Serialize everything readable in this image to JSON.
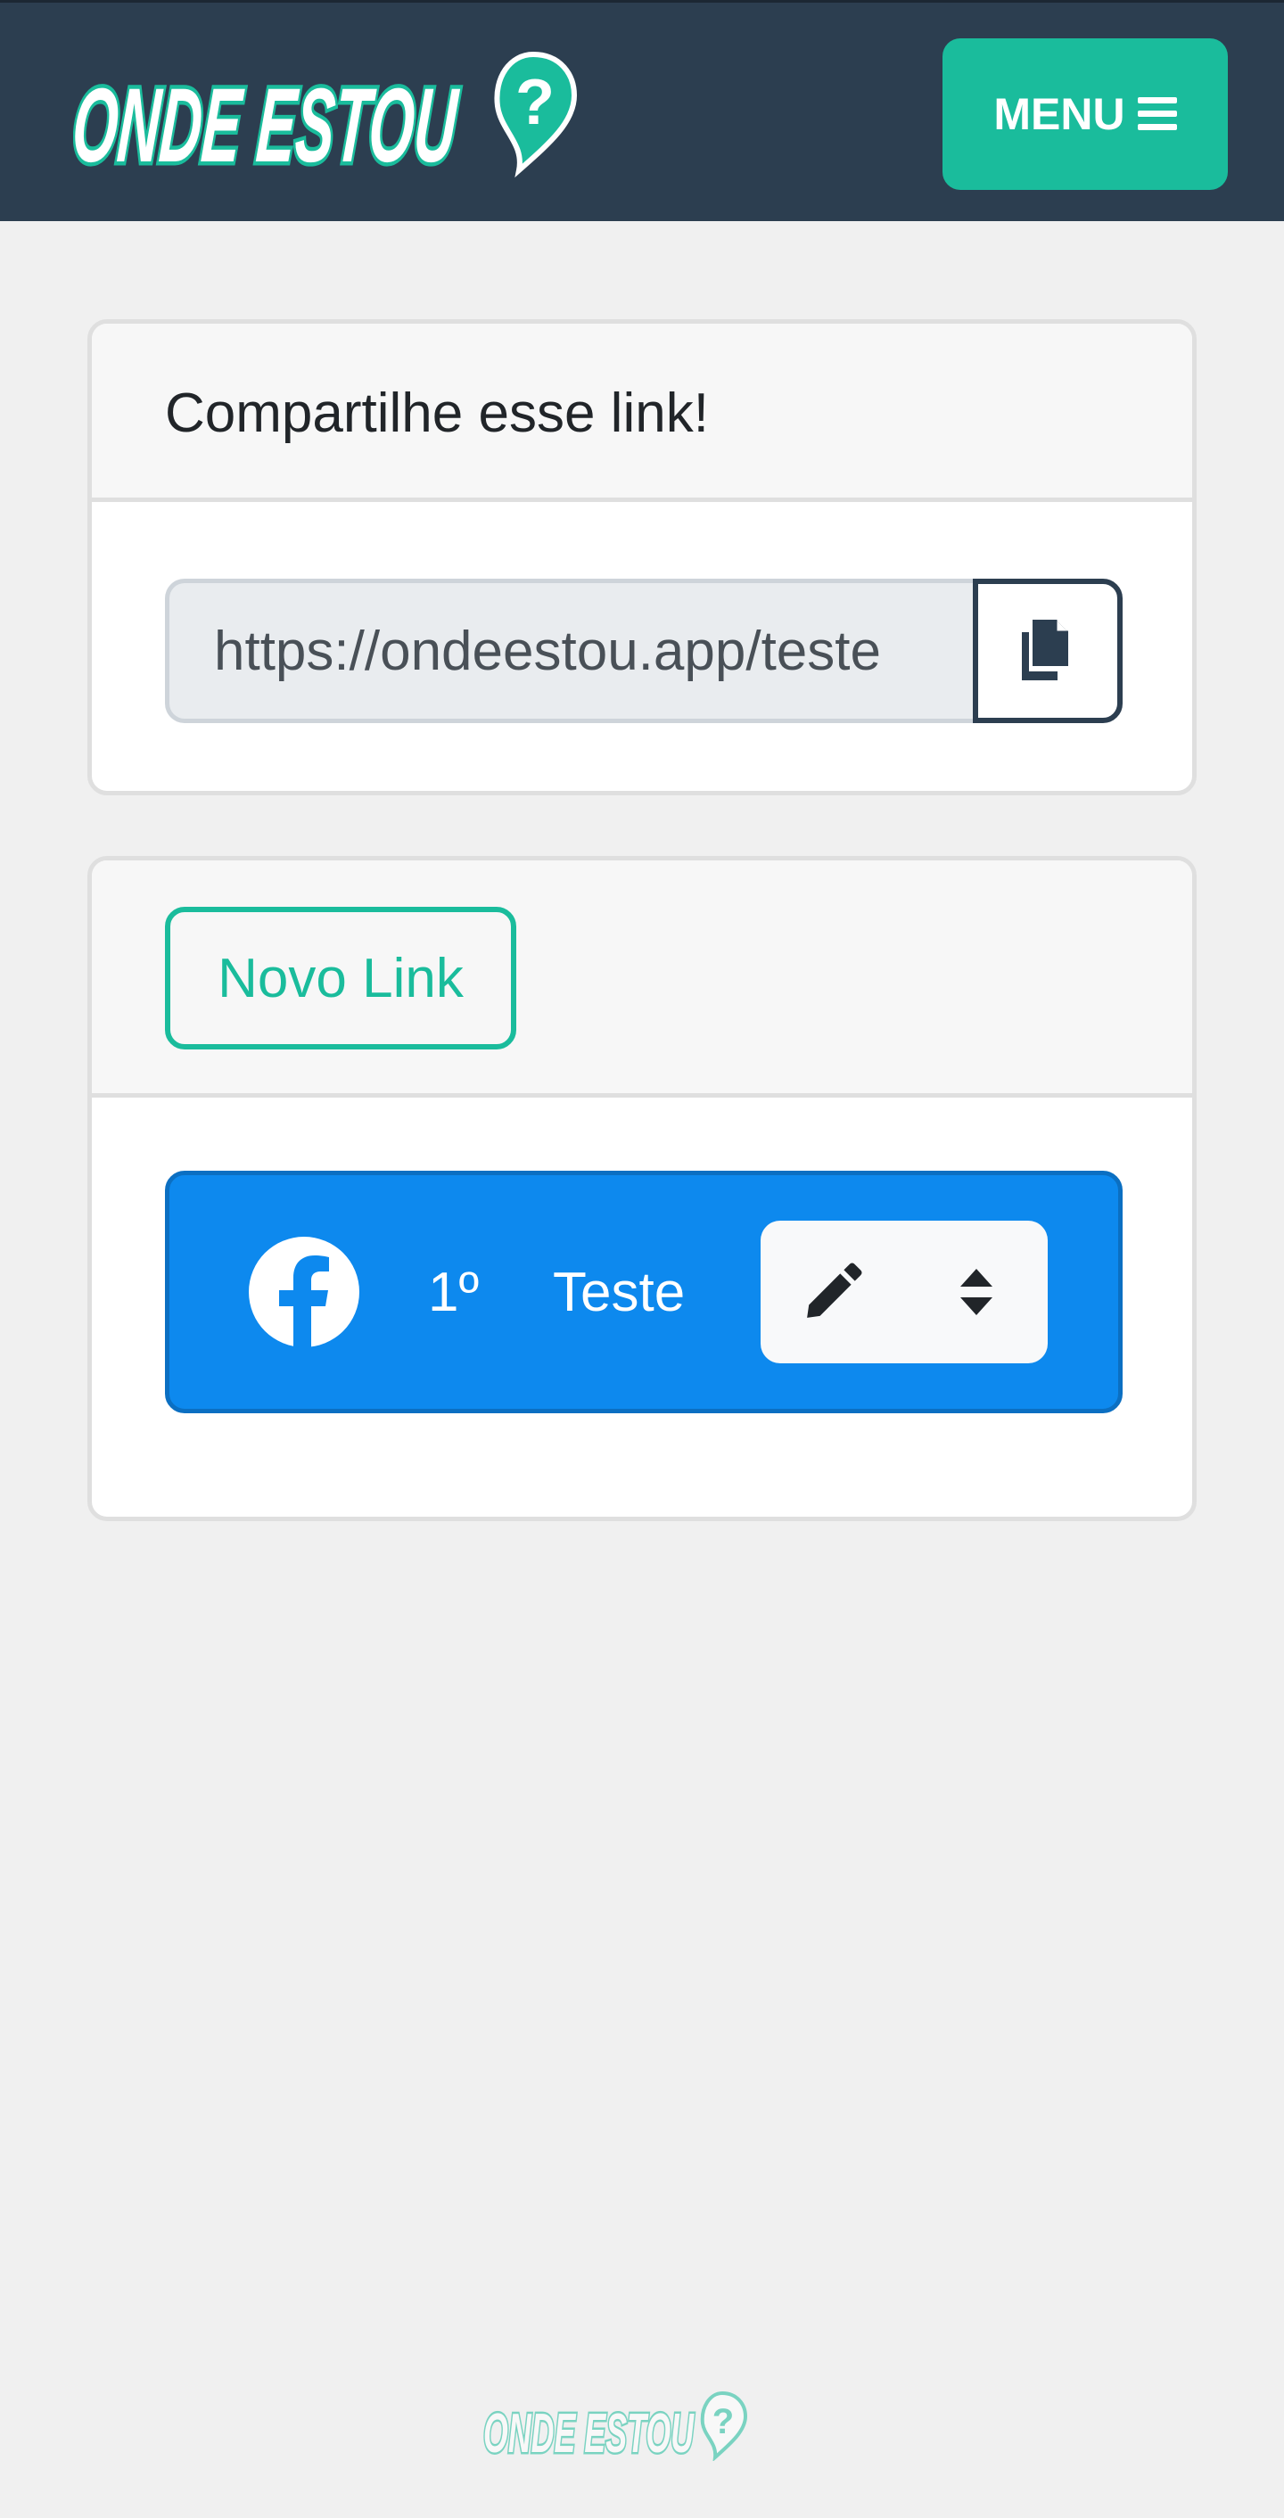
{
  "app": {
    "logo_text": "ONDE ESTOU",
    "brand_color": "#1abc9c",
    "navbar_color": "#2c3e50"
  },
  "navbar": {
    "menu_label": "MENU",
    "menu_icon": "bars-icon"
  },
  "share_card": {
    "title": "Compartilhe esse link!",
    "url_value": "https://ondeestou.app/teste",
    "copy_icon": "copy-icon"
  },
  "links_card": {
    "new_link_label": "Novo Link",
    "items": [
      {
        "icon": "facebook-icon",
        "order": "1º",
        "name": "Teste",
        "color": "#0d89ee",
        "actions": [
          "pencil-icon",
          "sort-icon"
        ]
      }
    ]
  },
  "footer": {
    "logo_text": "ONDE ESTOU"
  }
}
